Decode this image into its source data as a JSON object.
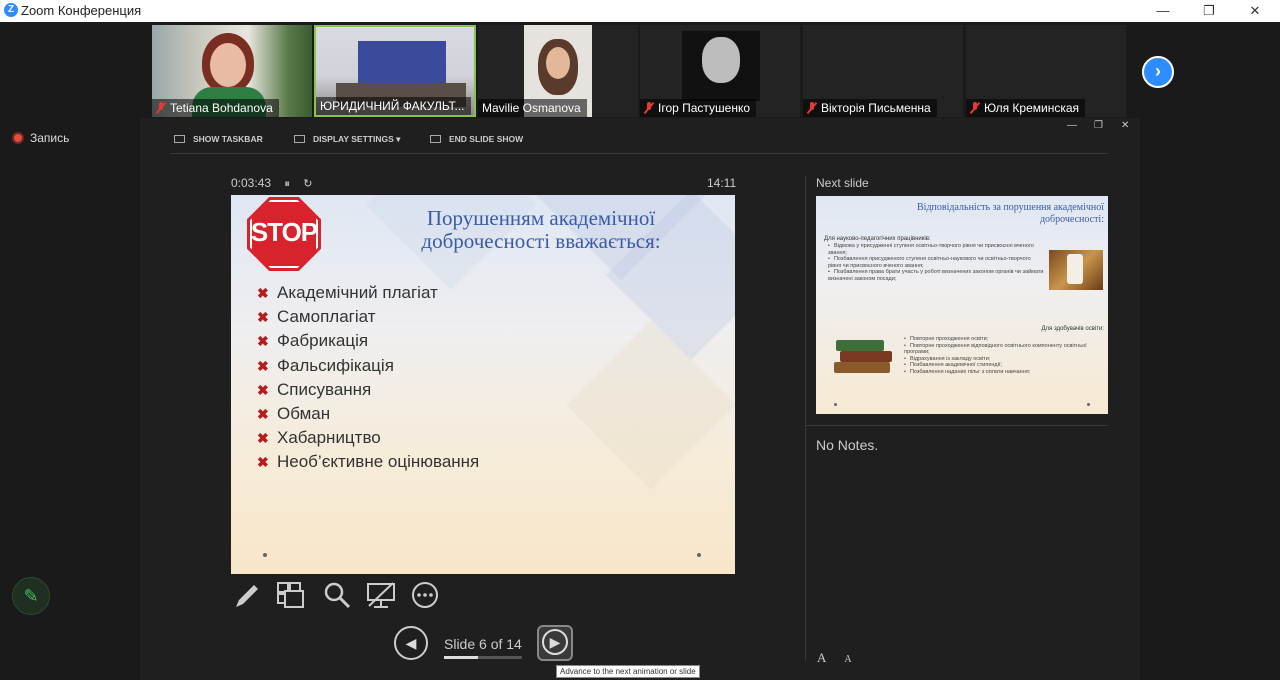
{
  "window": {
    "title": "Zoom Конференция",
    "minimize": "—",
    "restore": "❐",
    "close": "✕"
  },
  "participants": [
    {
      "name": "Tetiana Bohdanova",
      "muted": true
    },
    {
      "name": "ЮРИДИЧНИЙ ФАКУЛЬТ...",
      "muted": false
    },
    {
      "name": "Mavilie Osmanova",
      "muted": false
    },
    {
      "name": "Ігор Пастушенко",
      "muted": true
    },
    {
      "name": "Вікторія Письменна",
      "muted": true
    },
    {
      "name": "Юля Креминская",
      "muted": true
    }
  ],
  "recording": {
    "label": "Запись"
  },
  "presenter": {
    "toolbar": {
      "show_taskbar": "SHOW TASKBAR",
      "display_settings": "DISPLAY SETTINGS ▾",
      "end_slide_show": "END SLIDE SHOW"
    },
    "elapsed": "0:03:43",
    "pause_icon": "⏸",
    "reset_icon": "↻",
    "clock": "14:11",
    "slide_nav": {
      "prev_icon": "◀",
      "next_icon": "▶",
      "counter": "Slide 6 of 14",
      "progress": 0.43,
      "tooltip": "Advance to the next animation or slide"
    },
    "next_slide_label": "Next slide",
    "notes": "No Notes.",
    "font_increase": "A",
    "font_decrease": "A"
  },
  "current_slide": {
    "stop_sign": "STOP",
    "title_line1": "Порушенням академічної",
    "title_line2": "доброчесності вважається:",
    "bullet_icon": "✖",
    "items": [
      "Академічний плагіат",
      "Самоплагіат",
      "Фабрикація",
      "Фальсифікація",
      "Списування",
      "Обман",
      "Хабарництво",
      "Необ’єктивне оцінювання"
    ]
  },
  "next_slide": {
    "title_line1": "Відповідальність за порушення академічної",
    "title_line2": "доброчесності:",
    "section1_heading": "Для науково-педагогічних працівників:",
    "section1_items": [
      "Відмова у присудженні ступеня освітньо-творчого рівня чи присвоєнні вченого звання;",
      "Позбавлення присудженого ступеня освітньо-наукового чи освітньо-творчого рівня чи присвоєного вченого звання;",
      "Позбавлення права брати участь у роботі визначених законом органів чи займати визначені законом посади;"
    ],
    "section2_heading": "Для здобувачів освіти:",
    "section2_items": [
      "Повторне проходження освіти;",
      "Повторне проходження відповідного освітнього компоненту освітньої програми;",
      "Відрахування із закладу освіти;",
      "Позбавлення академічної стипендії;",
      "Позбавлення наданих пільг з оплати навчання;"
    ]
  },
  "colors": {
    "zoom_blue": "#2d8cff",
    "active_speaker": "#8bc34a",
    "muted_red": "#e53935",
    "stop_red": "#d9232c",
    "slide_title_blue": "#3b5aa8",
    "bullet_red": "#b71c1c"
  }
}
